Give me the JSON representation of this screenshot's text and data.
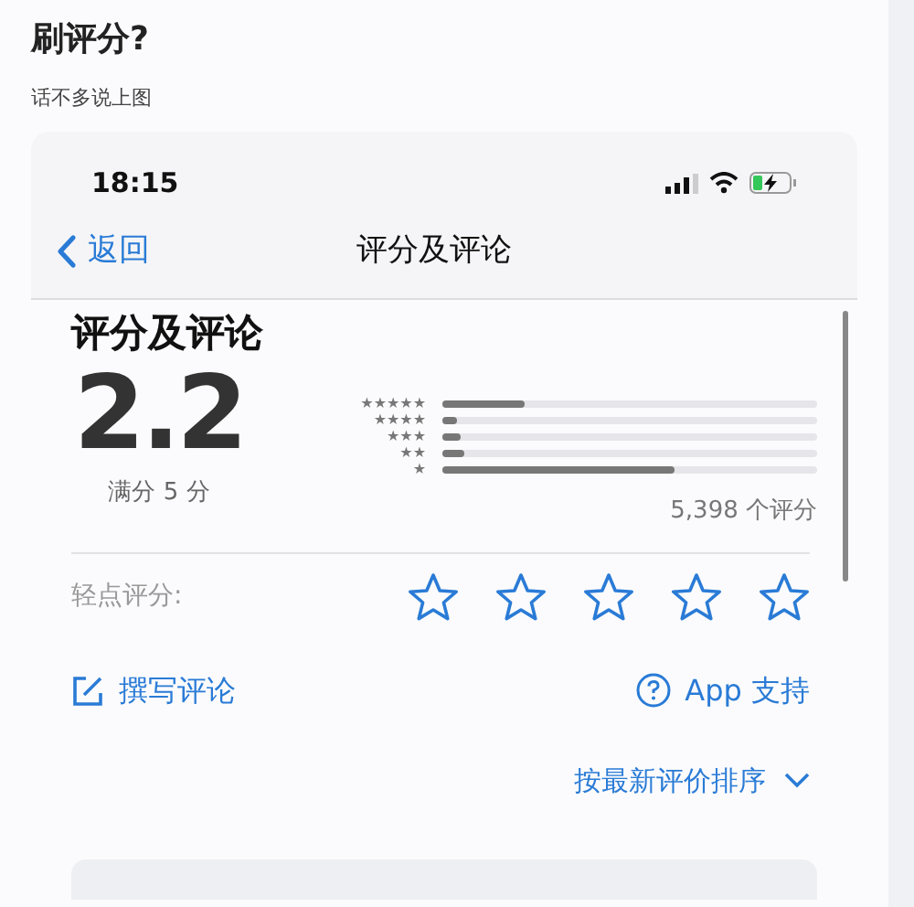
{
  "article": {
    "heading": "刷评分?",
    "intro": "话不多说上图"
  },
  "phone": {
    "status_bar": {
      "time": "18:15"
    },
    "nav": {
      "back": "返回",
      "title": "评分及评论"
    },
    "ratings": {
      "title": "评分及评论",
      "score": "2.2",
      "out_of": "满分 5 分",
      "count": "5,398 个评分",
      "histogram": [
        {
          "label": "★★★★★",
          "level": 0.22
        },
        {
          "label": "★★★★",
          "level": 0.04
        },
        {
          "label": "★★★",
          "level": 0.05
        },
        {
          "label": "★★",
          "level": 0.06
        },
        {
          "label": "★",
          "level": 0.62
        }
      ]
    },
    "tap_to_rate": {
      "label": "轻点评分:",
      "stars": 0
    },
    "write_review": "撰写评论",
    "app_support": "App 支持",
    "sort": "按最新评价排序"
  }
}
